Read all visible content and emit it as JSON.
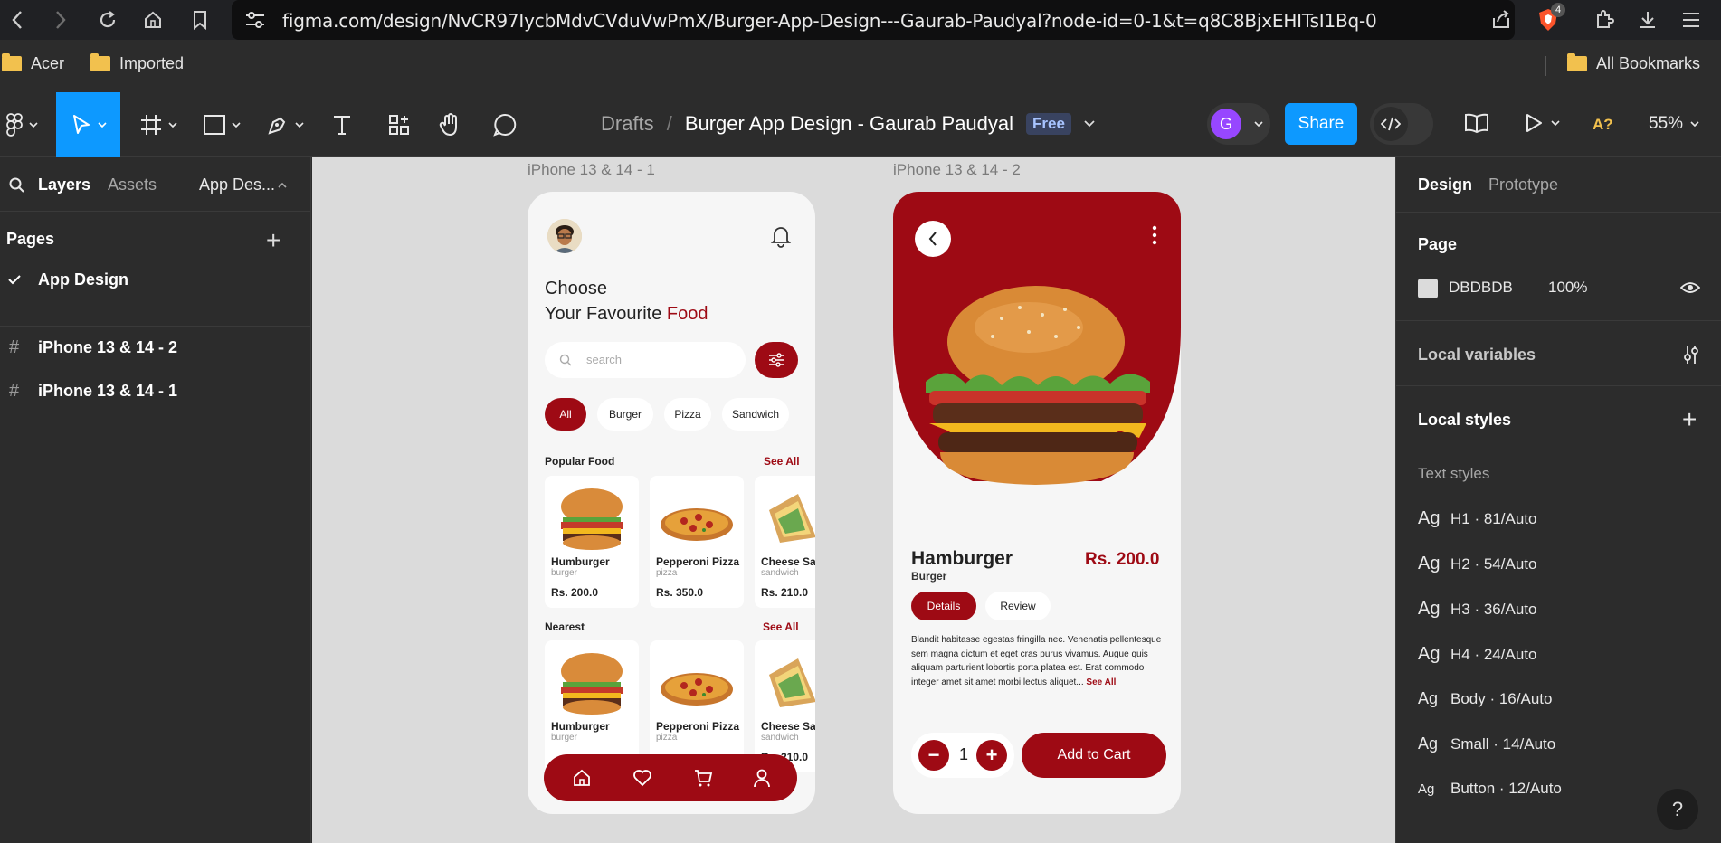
{
  "browser": {
    "url": "figma.com/design/NvCR97IycbMdvCVduVwPmX/Burger-App-Design---Gaurab-Paudyal?node-id=0-1&t=q8C8BjxEHITsI1Bq-0",
    "notification_count": "4"
  },
  "bookmarks": {
    "items": [
      "Acer",
      "Imported"
    ],
    "all_label": "All Bookmarks"
  },
  "toolbar": {
    "breadcrumb_parent": "Drafts",
    "breadcrumb_sep": "/",
    "file_name": "Burger App Design - Gaurab Paudyal",
    "plan_badge": "Free",
    "user_initial": "G",
    "share_label": "Share",
    "font_warning": "A?",
    "zoom": "55%"
  },
  "left_panel": {
    "tabs": [
      "Layers",
      "Assets"
    ],
    "page_dropdown": "App Des...",
    "pages_heading": "Pages",
    "current_page": "App Design",
    "layers": [
      "iPhone 13 & 14 - 2",
      "iPhone 13 & 14 - 1"
    ]
  },
  "canvas": {
    "background": "#DBDBDB",
    "frame1_label": "iPhone 13 & 14 - 1",
    "frame2_label": "iPhone 13 & 14 - 2"
  },
  "frame1": {
    "title_line1": "Choose",
    "title_line2_prefix": "Your Favourite ",
    "title_line2_accent": "Food",
    "search_placeholder": "search",
    "chips": [
      "All",
      "Burger",
      "Pizza",
      "Sandwich"
    ],
    "popular_heading": "Popular Food",
    "nearest_heading": "Nearest",
    "see_all": "See All",
    "popular_cards": [
      {
        "name": "Humburger",
        "category": "burger",
        "price": "Rs. 200.0"
      },
      {
        "name": "Pepperoni Pizza",
        "category": "pizza",
        "price": "Rs. 350.0"
      },
      {
        "name": "Cheese Sandwich",
        "category": "sandwich",
        "price": "Rs. 210.0"
      }
    ],
    "nearest_cards": [
      {
        "name": "Humburger",
        "category": "burger"
      },
      {
        "name": "Pepperoni Pizza",
        "category": "pizza"
      },
      {
        "name": "Cheese Sandwich",
        "category": "sandwich",
        "price": "Rs. 210.0"
      }
    ]
  },
  "frame2": {
    "product_name": "Hamburger",
    "product_category": "Burger",
    "price": "Rs. 200.0",
    "tabs": [
      "Details",
      "Review"
    ],
    "description": "Blandit habitasse egestas fringilla nec. Venenatis pellentesque sem magna dictum et eget cras purus vivamus. Augue quis aliquam parturient lobortis porta platea est. Erat commodo integer amet sit amet morbi lectus aliquet...",
    "see_all": "See All",
    "quantity": "1",
    "add_to_cart": "Add to Cart"
  },
  "right_panel": {
    "tabs": [
      "Design",
      "Prototype"
    ],
    "page_heading": "Page",
    "page_color": "DBDBDB",
    "page_opacity": "100%",
    "local_variables": "Local variables",
    "local_styles": "Local styles",
    "text_styles_heading": "Text styles",
    "text_styles": [
      {
        "ag": "Ag",
        "name": "H1",
        "spec": " · 81/Auto"
      },
      {
        "ag": "Ag",
        "name": "H2",
        "spec": " · 54/Auto"
      },
      {
        "ag": "Ag",
        "name": "H3",
        "spec": " · 36/Auto"
      },
      {
        "ag": "Ag",
        "name": "H4",
        "spec": " · 24/Auto"
      },
      {
        "ag": "Ag",
        "name": "Body",
        "spec": " · 16/Auto"
      },
      {
        "ag": "Ag",
        "name": "Small",
        "spec": " · 14/Auto"
      },
      {
        "ag": "Ag",
        "name": "Button",
        "spec": " · 12/Auto"
      }
    ],
    "help": "?"
  },
  "colors": {
    "brand_red": "#9E0A14",
    "figma_blue": "#0D99FF",
    "panel_bg": "#2C2C2C"
  }
}
